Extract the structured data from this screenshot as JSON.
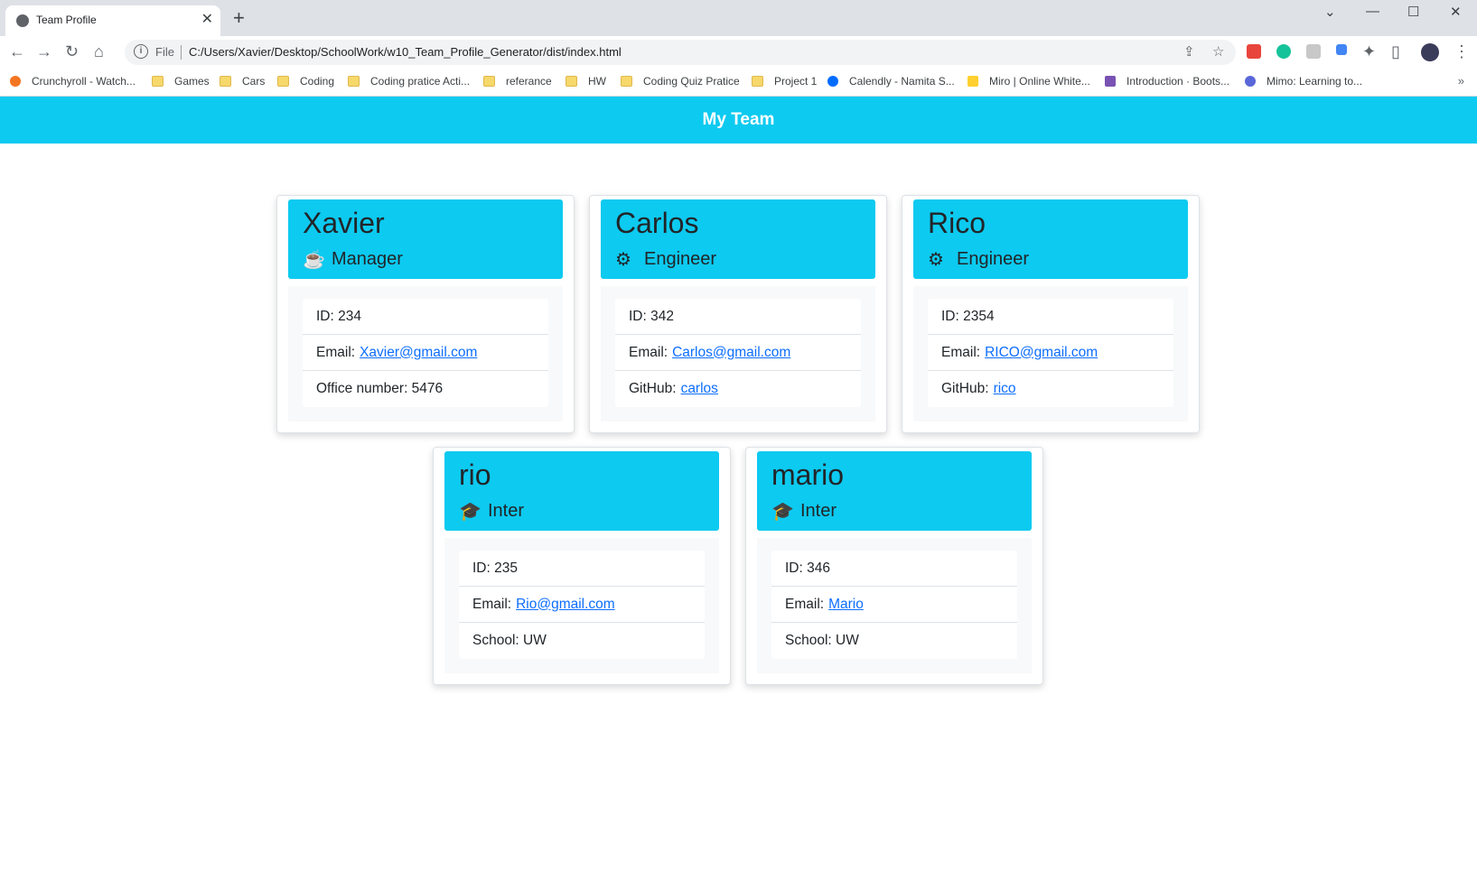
{
  "browser": {
    "tab_title": "Team Profile",
    "omnibox_scheme": "File",
    "url": "C:/Users/Xavier/Desktop/SchoolWork/w10_Team_Profile_Generator/dist/index.html",
    "bookmarks": [
      "Crunchyroll - Watch...",
      "Games",
      "Cars",
      "Coding",
      "Coding pratice Acti...",
      "referance",
      "HW",
      "Coding Quiz Pratice",
      "Project 1",
      "Calendly - Namita S...",
      "Miro | Online White...",
      "Introduction · Boots...",
      "Mimo: Learning to..."
    ]
  },
  "page": {
    "title": "My Team",
    "accent_color": "#0dcaf0",
    "members": [
      {
        "name": "Xavier",
        "role": "Manager",
        "icon": "coffee-icon",
        "id": "ID: 234",
        "email_label": "Email:",
        "email": "Xavier@gmail.com",
        "extra_label": "Office number: 5476",
        "extra_link": ""
      },
      {
        "name": "Carlos",
        "role": "Engineer",
        "icon": "cogs-icon",
        "id": "ID: 342",
        "email_label": "Email:",
        "email": "Carlos@gmail.com",
        "extra_label": "GitHub:",
        "extra_link": "carlos"
      },
      {
        "name": "Rico",
        "role": "Engineer",
        "icon": "cogs-icon",
        "id": "ID: 2354",
        "email_label": "Email:",
        "email": "RICO@gmail.com",
        "extra_label": "GitHub:",
        "extra_link": "rico"
      },
      {
        "name": "rio",
        "role": "Inter",
        "icon": "graduation-cap-icon",
        "id": "ID: 235",
        "email_label": "Email:",
        "email": "Rio@gmail.com",
        "extra_label": "School: UW",
        "extra_link": ""
      },
      {
        "name": "mario",
        "role": "Inter",
        "icon": "graduation-cap-icon",
        "id": "ID: 346",
        "email_label": "Email:",
        "email": "Mario",
        "extra_label": "School: UW",
        "extra_link": ""
      }
    ]
  }
}
